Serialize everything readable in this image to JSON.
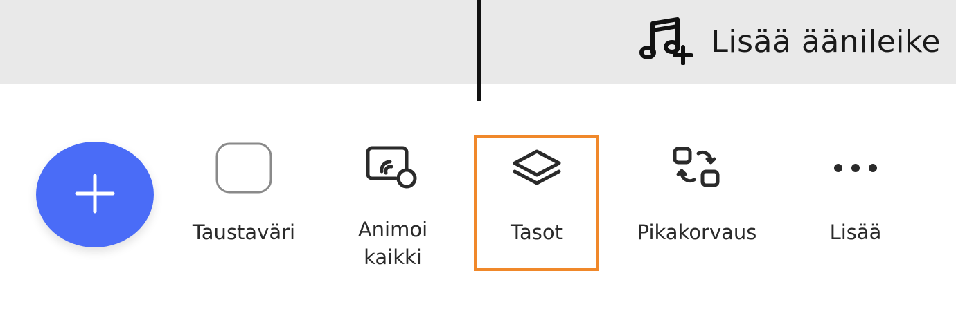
{
  "header": {
    "add_audio_label": "Lisää äänileike",
    "add_audio_icon": "music-note-plus-icon"
  },
  "fab": {
    "icon": "plus-icon",
    "color": "#4a6cf7"
  },
  "toolbar": {
    "items": [
      {
        "label": "Taustaväri",
        "icon": "rounded-square-icon",
        "selected": false
      },
      {
        "label": "Animoi\nkaikki",
        "icon": "animate-all-icon",
        "selected": false
      },
      {
        "label": "Tasot",
        "icon": "layers-icon",
        "selected": true
      },
      {
        "label": "Pikakorvaus",
        "icon": "swap-icon",
        "selected": false
      },
      {
        "label": "Lisää",
        "icon": "more-dots-icon",
        "selected": false
      }
    ]
  },
  "colors": {
    "highlight": "#f0882a",
    "strip": "#e9e9e9"
  }
}
